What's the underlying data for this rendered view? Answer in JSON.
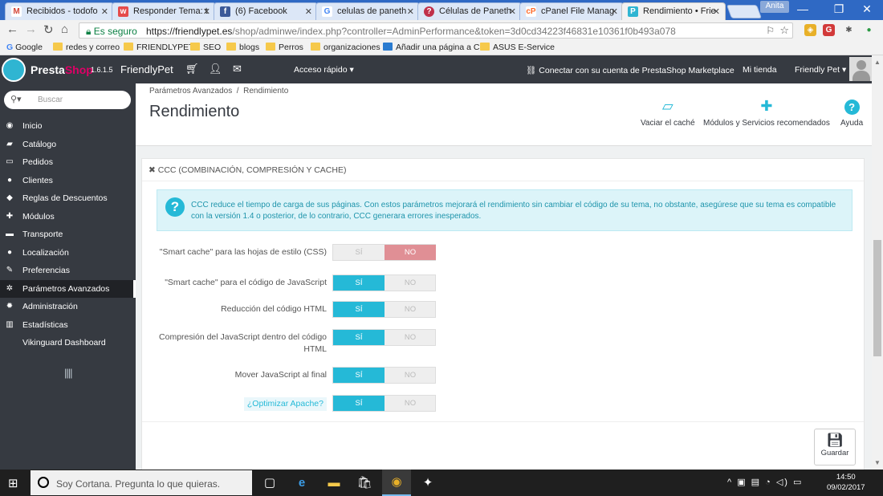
{
  "browser": {
    "tabs": [
      {
        "title": "Recibidos - todofo",
        "favicon": "gmail-icon",
        "color": "#d44638",
        "glyph": "M"
      },
      {
        "title": "Responder Tema: t",
        "favicon": "w-icon",
        "color": "#e54b4b",
        "glyph": "w"
      },
      {
        "title": "(6) Facebook",
        "favicon": "facebook-icon",
        "color": "#3b5998",
        "glyph": "f"
      },
      {
        "title": "celulas de paneth",
        "favicon": "google-icon",
        "color": "#4285f4",
        "glyph": "G"
      },
      {
        "title": "Células de Paneth",
        "favicon": "question-icon",
        "color": "#c0314a",
        "glyph": "?"
      },
      {
        "title": "cPanel File Manag",
        "favicon": "cpanel-icon",
        "color": "#ff6c2c",
        "glyph": "cP"
      },
      {
        "title": "Rendimiento • Frie",
        "favicon": "prestashop-icon",
        "color": "#2fb5d2",
        "glyph": "P"
      }
    ],
    "profile_name": "Anita",
    "secure_label": "Es seguro",
    "url_host": "https://friendlypet.es",
    "url_path": "/shop/adminwe/index.php?controller=AdminPerformance&token=3d0cd34223f46831e10361f0b493a078",
    "bookmarks": [
      "Google",
      "redes y correo",
      "FRIENDLYPET",
      "SEO",
      "blogs",
      "Perros",
      "organizaciones",
      "Añadir una página a C",
      "ASUS E-Service"
    ]
  },
  "header": {
    "brand_a": "Presta",
    "brand_b": "Shop",
    "version": "1.6.1.5",
    "shop_name": "FriendlyPet",
    "quick_access": "Acceso rápido ▾",
    "marketplace": "Conectar con su cuenta de PrestaShop Marketplace",
    "my_shop": "Mi tienda",
    "user": "Friendly Pet ▾"
  },
  "sidebar": {
    "search_placeholder": "Buscar",
    "items": [
      {
        "label": "Inicio",
        "icon": "dashboard-icon",
        "glyph": "◉",
        "active": false
      },
      {
        "label": "Catálogo",
        "icon": "book-icon",
        "glyph": "▰",
        "active": false
      },
      {
        "label": "Pedidos",
        "icon": "credit-card-icon",
        "glyph": "▭",
        "active": false
      },
      {
        "label": "Clientes",
        "icon": "users-icon",
        "glyph": "●",
        "active": false
      },
      {
        "label": "Reglas de Descuentos",
        "icon": "tag-icon",
        "glyph": "◆",
        "active": false
      },
      {
        "label": "Módulos",
        "icon": "puzzle-icon",
        "glyph": "✚",
        "active": false
      },
      {
        "label": "Transporte",
        "icon": "truck-icon",
        "glyph": "▬",
        "active": false
      },
      {
        "label": "Localización",
        "icon": "globe-icon",
        "glyph": "●",
        "active": false
      },
      {
        "label": "Preferencias",
        "icon": "wrench-icon",
        "glyph": "✎",
        "active": false
      },
      {
        "label": "Parámetros Avanzados",
        "icon": "cogs-icon",
        "glyph": "✲",
        "active": true
      },
      {
        "label": "Administración",
        "icon": "cog-icon",
        "glyph": "✹",
        "active": false
      },
      {
        "label": "Estadísticas",
        "icon": "bar-chart-icon",
        "glyph": "▥",
        "active": false
      },
      {
        "label": "Vikinguard Dashboard",
        "icon": "",
        "glyph": "",
        "active": false
      }
    ]
  },
  "page": {
    "breadcrumb_parent": "Parámetros Avanzados",
    "breadcrumb_sep": "/",
    "breadcrumb_current": "Rendimiento",
    "title": "Rendimiento",
    "toolbar": {
      "clear_cache": "Vaciar el caché",
      "modules": "Módulos y Servicios recomendados",
      "help": "Ayuda"
    }
  },
  "panel": {
    "heading": "CCC (COMBINACIÓN, COMPRESIÓN Y CACHE)",
    "alert": "CCC reduce el tiempo de carga de sus páginas. Con estos parámetros mejorará el rendimiento sin cambiar el código de su tema, no obstante, asegúrese que su tema es compatible con la versión 1.4 o posterior, de lo contrario, CCC generara errores inesperados.",
    "yes_label": "SÍ",
    "no_label": "NO",
    "save_label": "Guardar",
    "rows": [
      {
        "label": "\"Smart cache\" para las hojas de estilo (CSS)",
        "value": "no"
      },
      {
        "label": "\"Smart cache\" para el código de JavaScript",
        "value": "si"
      },
      {
        "label": "Reducción del código HTML",
        "value": "si"
      },
      {
        "label": "Compresión del JavaScript dentro del código HTML",
        "value": "si"
      },
      {
        "label": "Mover JavaScript al final",
        "value": "si"
      },
      {
        "label": "¿Optimizar Apache?",
        "value": "si",
        "link": true
      }
    ]
  },
  "taskbar": {
    "cortana_text": "Soy Cortana. Pregunta lo que quieras.",
    "time": "14:50",
    "date": "09/02/2017"
  },
  "colors": {
    "accent": "#25b9d7",
    "danger": "#e08f95",
    "header_bg": "#363a41"
  }
}
